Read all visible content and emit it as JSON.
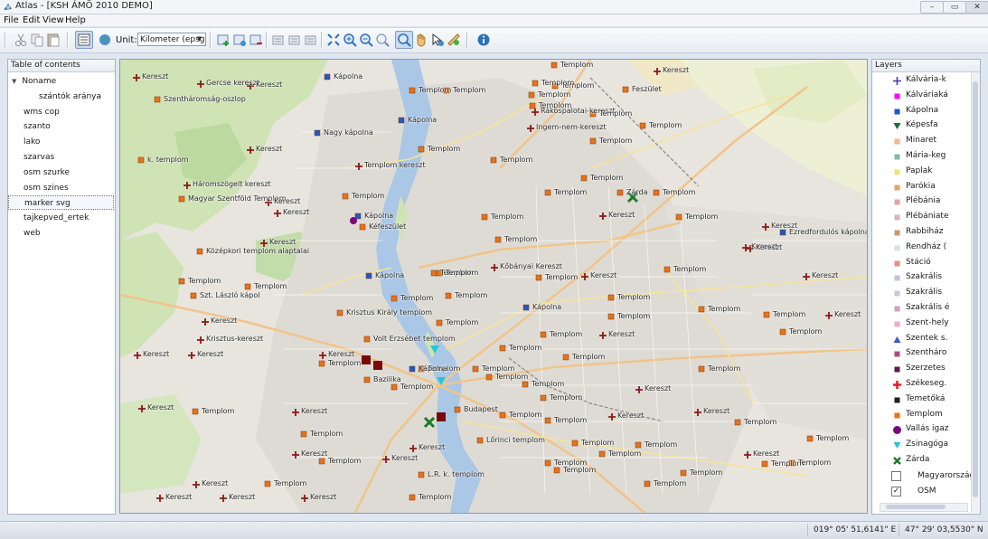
{
  "window": {
    "title": "Atlas - [KSH ÁMÖ 2010 DEMO]",
    "minimize": "–",
    "maximize": "▭",
    "close": "✕"
  },
  "menu": [
    "File",
    "Edit",
    "View",
    "Help"
  ],
  "toolbar": {
    "unit_label": "Unit:",
    "unit_value": "Kilometer (epsg:"
  },
  "toc": {
    "header": "Table of contents",
    "items": [
      {
        "label": "Noname",
        "indent": 0,
        "expand": "▼"
      },
      {
        "label": "szántók aránya",
        "indent": 2
      },
      {
        "label": "wms cop",
        "indent": 0
      },
      {
        "label": "szanto",
        "indent": 0
      },
      {
        "label": "lako",
        "indent": 0
      },
      {
        "label": "szarvas",
        "indent": 0
      },
      {
        "label": "osm szurke",
        "indent": 0
      },
      {
        "label": "osm szines",
        "indent": 0
      },
      {
        "label": "marker svg",
        "indent": 0,
        "selected": true
      },
      {
        "label": "tajkepved_ertek",
        "indent": 0
      },
      {
        "label": "web",
        "indent": 0
      }
    ]
  },
  "layers": {
    "header": "Layers",
    "items": [
      {
        "label": "Kálvária-k",
        "color": "#4b3aa8",
        "shape": "cross"
      },
      {
        "label": "Kálváriaká",
        "color": "#ff00ff",
        "shape": "square"
      },
      {
        "label": "Kápolna",
        "color": "#2457c8",
        "shape": "square"
      },
      {
        "label": "Képesfa",
        "color": "#1f6b3a",
        "shape": "triangle-down"
      },
      {
        "label": "Minaret",
        "color": "#f3b58a",
        "shape": "square"
      },
      {
        "label": "Mária-keg",
        "color": "#7fb8b0",
        "shape": "square"
      },
      {
        "label": "Paplak",
        "color": "#f2e07a",
        "shape": "square"
      },
      {
        "label": "Parókia",
        "color": "#e3a46a",
        "shape": "square"
      },
      {
        "label": "Plébánia",
        "color": "#e8a0a8",
        "shape": "square"
      },
      {
        "label": "Plébániate",
        "color": "#d8b0c8",
        "shape": "square"
      },
      {
        "label": "Rabbiház",
        "color": "#c49a6a",
        "shape": "square"
      },
      {
        "label": "Rendház (",
        "color": "#cfe8d8",
        "shape": "square"
      },
      {
        "label": "Stáció",
        "color": "#f08a8a",
        "shape": "square"
      },
      {
        "label": "Szakrális",
        "color": "#b8c8e0",
        "shape": "square"
      },
      {
        "label": "Szakrális",
        "color": "#c8c8d8",
        "shape": "square"
      },
      {
        "label": "Szakrális é",
        "color": "#d89ac8",
        "shape": "square"
      },
      {
        "label": "Szent-hely",
        "color": "#f4a8c8",
        "shape": "square"
      },
      {
        "label": "Szentek s.",
        "color": "#3a5ad0",
        "shape": "triangle-up"
      },
      {
        "label": "Szentháro",
        "color": "#b04a7a",
        "shape": "square"
      },
      {
        "label": "Szerzetes",
        "color": "#5a1a4a",
        "shape": "square"
      },
      {
        "label": "Székeseg.",
        "color": "#e0202a",
        "shape": "bigcross"
      },
      {
        "label": "Temetőká",
        "color": "#202020",
        "shape": "square"
      },
      {
        "label": "Templom",
        "color": "#e8721a",
        "shape": "square"
      },
      {
        "label": "Vallás igaz",
        "color": "#7a0a7a",
        "shape": "circle"
      },
      {
        "label": "Zsinagóga",
        "color": "#20c8d8",
        "shape": "triangle-down"
      },
      {
        "label": "Zárda",
        "color": "#1a7a2a",
        "shape": "x"
      }
    ],
    "bottom": [
      {
        "label": "Magyarország",
        "checked": false,
        "check": ""
      },
      {
        "label": "OSM",
        "checked": true,
        "check": "✓"
      }
    ]
  },
  "map_labels": [
    "Kereszt",
    "Gercse kereszt",
    "Kereszt",
    "Kápolna",
    "Templom",
    "Templom",
    "Kereszt",
    "Szentháromság-oszlop",
    "Templom",
    "Templom",
    "Templom",
    "Feszület",
    "Templom",
    "Kápolna",
    "Templom",
    "Rákospalotai-kereszt",
    "Templom",
    "Ingem-nem-kereszt",
    "Templom",
    "Templom",
    "Nagy kápolna",
    "Kereszt",
    "Templom",
    "k. templom",
    "Templom kereszt",
    "Templom",
    "Templom",
    "Templom",
    "Háromszögelt kereszt",
    "Magyar Szentföld Templom",
    "Kereszt",
    "Templom",
    "Kápolna",
    "Kéfeszület",
    "Kereszt",
    "Kereszt",
    "Templom",
    "Templom",
    "Templom",
    "Templom",
    "Kápolna",
    "Templom",
    "Zárda",
    "Templom",
    "Kereszt",
    "Kereszt",
    "Középkori templom alaptalai",
    "Kereszt",
    "Kőbányai Kereszt",
    "Templom",
    "Templom",
    "Templom",
    "Templom",
    "Templom",
    "Szt. László kápol",
    "Ezredfordulós kápolna",
    "Kereszt",
    "Kápolna",
    "Templom",
    "Kereszt",
    "Templom",
    "Templom",
    "Templom",
    "Kereszt",
    "Krisztus Király templom",
    "Templom",
    "Kereszt",
    "Templom",
    "Kereszt",
    "Templom",
    "Templom",
    "Templom",
    "Krisztus-kereszt",
    "Volt Erzsébet templom",
    "Templom",
    "Templom",
    "Templom",
    "Kereszt",
    "Kereszt",
    "Kereszt",
    "Kereszt",
    "Templom",
    "Bazilika",
    "Budapest",
    "Templom",
    "Templom",
    "Lőrinci templom",
    "Templom",
    "Templom",
    "Templom",
    "Templom",
    "Templom",
    "Kereszt",
    "Kereszt",
    "Kereszt",
    "Kereszt",
    "Templom",
    "Templom",
    "Kápolna",
    "Templom",
    "Templom",
    "Templom",
    "Templom",
    "Templom",
    "Kereszt",
    "Kereszt",
    "Kereszt",
    "Kereszt",
    "Kereszt",
    "Templom",
    "Templom",
    "Templom",
    "Kereszt",
    "L.R. k. templom",
    "Templom",
    "Kereszt",
    "Templom",
    "Kereszt",
    "Templom",
    "Kereszt",
    "Templom",
    "Templom",
    "Templom"
  ],
  "status": {
    "left": "",
    "lon": "019° 05' 51,6141\" E",
    "lat": "47° 29' 03,5530\" N"
  }
}
